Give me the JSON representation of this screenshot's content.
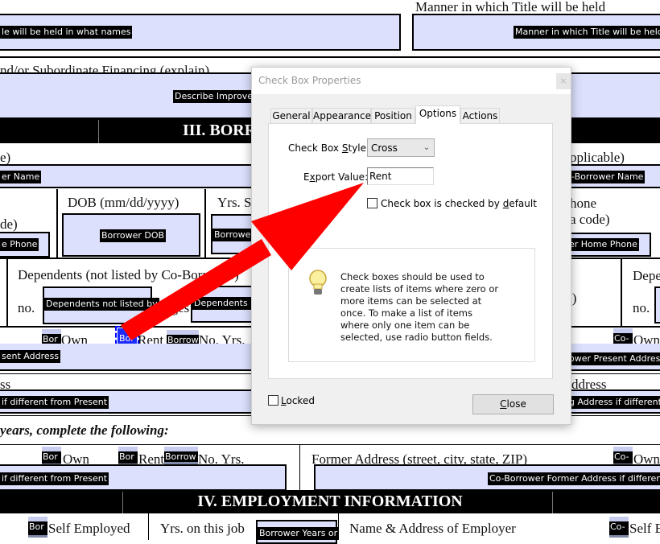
{
  "form": {
    "title_names_field": "le will be held in what names",
    "manner_label": "Manner in which Title will be held",
    "manner_field": "Manner in which Title will be held",
    "subordinate_label": "nd/or Subordinate Financing (explain)",
    "describe_field": "Describe Improver",
    "section3_title": "III. BORR",
    "left_paren": "e)",
    "if_applicable": "pplicable)",
    "borrower_name_field": "er Name",
    "coborrower_name_field": "-Borrower Name",
    "dob_label": "DOB (mm/dd/yyyy)",
    "yrs_school_label": "Yrs. S",
    "area_code_left": "de)",
    "home_phone_field": "e Phone",
    "dob_field": "Borrower DOB",
    "yrs_field": "Borrower",
    "phone_right": "hone",
    "area_code_right": "a code)",
    "co_home_phone_field": "er Home Phone",
    "dependents_label": "Dependents (not listed by Co-Borrower)",
    "no_label": "no.",
    "dependents_field": "Dependents not listed by",
    "ages_label": "ages",
    "dependents_ages_field": "Dependents n",
    "right_paren": "l)",
    "co_dependents_label": "Depe",
    "co_no_label": "no.",
    "bor_cb": "Bor",
    "own": "Own",
    "rent": "Rent",
    "borrow_cb": "Borrow",
    "no_yrs": "No. Yrs.",
    "co_cb": "Co-",
    "present_address_field": "sent Address",
    "co_present_address_field": "ower Present Address",
    "address_left": "ss",
    "address_right": "ddress",
    "mailing_field": " if different from Present",
    "co_mailing_field": "g Address if different",
    "years_instruction": "years, complete the following:",
    "former_address_label": "Former Address (street, city, state, ZIP)",
    "former_field": " if different from Present",
    "co_former_field": "Co-Borrower Former Address if different",
    "section4_title": "IV. EMPLOYMENT INFORMATION",
    "self_employed": "Self Employed",
    "yrs_on_job": "Yrs. on this job",
    "yrs_job_field": "Borrower Years or",
    "employer_label": "Name & Address of Employer",
    "co_self_employed": "Self E"
  },
  "dialog": {
    "title": "Check Box Properties",
    "close_x": "×",
    "tabs": [
      "General",
      "Appearance",
      "Position",
      "Options",
      "Actions"
    ],
    "active_tab": "Options",
    "style_label_pre": "Check Box ",
    "style_label_ul": "S",
    "style_label_post": "tyle:",
    "style_value": "Cross",
    "export_label_pre": "E",
    "export_label_ul": "x",
    "export_label_post": "port Value:",
    "export_value": "Rent",
    "default_pre": "Check box is checked by ",
    "default_ul": "d",
    "default_post": "efault",
    "default_checked": false,
    "info_text": "Check boxes should be used to create lists of items where zero or more items can be selected at once. To make a list of items where only one item can be selected, use radio button fields.",
    "locked_ul": "L",
    "locked_post": "ocked",
    "locked_checked": false,
    "close_ul": "C",
    "close_post": "lose"
  },
  "colors": {
    "field": "#dce0fc",
    "arrow": "#ff0000",
    "selection": "#0000ff"
  }
}
